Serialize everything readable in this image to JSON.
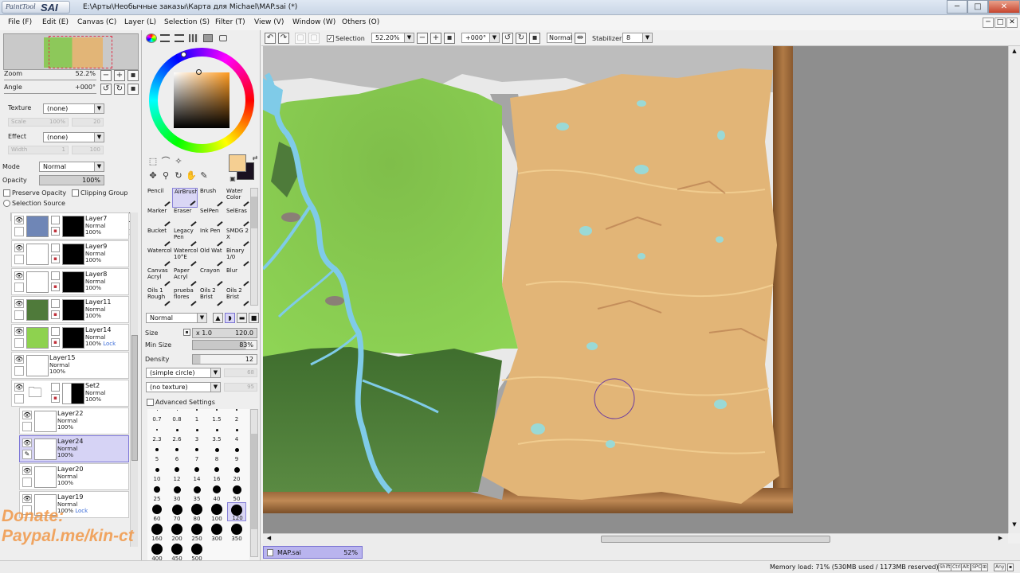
{
  "app": {
    "logo_small": "PaintTool",
    "logo_big": "SAI",
    "title": "E:\\Арты\\Необычные заказы\\Карта для Michael\\MAP.sai (*)"
  },
  "window_buttons": {
    "minimize": "─",
    "maximize": "□",
    "close": "✕"
  },
  "menu": [
    "File (F)",
    "Edit (E)",
    "Canvas (C)",
    "Layer (L)",
    "Selection (S)",
    "Filter (T)",
    "View (V)",
    "Window (W)",
    "Others (O)"
  ],
  "navigator": {
    "zoom_label": "Zoom",
    "zoom_value": "52.2%",
    "angle_label": "Angle",
    "angle_value": "+000°"
  },
  "layer_props": {
    "texture_label": "Texture",
    "texture_value": "(none)",
    "scale_label": "Scale",
    "scale_value": "100%",
    "scale_num": "20",
    "effect_label": "Effect",
    "effect_value": "(none)",
    "width_label": "Width",
    "width_value": "1",
    "width_num": "100",
    "mode_label": "Mode",
    "mode_value": "Normal",
    "opacity_label": "Opacity",
    "opacity_value": "100%",
    "preserve_opacity": "Preserve Opacity",
    "clipping_group": "Clipping Group",
    "selection_source": "Selection Source"
  },
  "layers": [
    {
      "name": "Layer7",
      "mode": "Normal",
      "opacity": "100%",
      "thumb_color": "#6f86b6",
      "mask": true
    },
    {
      "name": "Layer9",
      "mode": "Normal",
      "opacity": "100%",
      "thumb_color": "#f4f4f4",
      "mask": true
    },
    {
      "name": "Layer8",
      "mode": "Normal",
      "opacity": "100%",
      "thumb_color": "#f4f4f4",
      "mask": true
    },
    {
      "name": "Layer11",
      "mode": "Normal",
      "opacity": "100%",
      "thumb_color": "#4f7a3a",
      "mask": true
    },
    {
      "name": "Layer14",
      "mode": "Normal",
      "opacity": "100%",
      "lock": "Lock",
      "thumb_color": "#8ed24f",
      "mask": true
    },
    {
      "name": "Layer15",
      "mode": "Normal",
      "opacity": "100%",
      "thumb_color": "#f4f4f4",
      "mask": false
    },
    {
      "name": "Set2",
      "mode": "Normal",
      "opacity": "100%",
      "thumb_color": "#f4f4f4",
      "mask": true,
      "folder": true
    },
    {
      "name": "Layer22",
      "mode": "Normal",
      "opacity": "100%",
      "thumb_color": "#f4f4f4",
      "mask": false,
      "sub": true
    },
    {
      "name": "Layer24",
      "mode": "Normal",
      "opacity": "100%",
      "thumb_color": "#f4f4f4",
      "mask": false,
      "sub": true,
      "selected": true
    },
    {
      "name": "Layer20",
      "mode": "Normal",
      "opacity": "100%",
      "thumb_color": "#f4f4f4",
      "mask": false,
      "sub": true
    },
    {
      "name": "Layer19",
      "mode": "Normal",
      "opacity": "100%",
      "lock": "Lock",
      "thumb_color": "#f4f4f4",
      "mask": false,
      "sub": true
    }
  ],
  "watermark": {
    "line1": "Donate:",
    "line2": "Paypal.me/kin-ct"
  },
  "tools": [
    {
      "label": "Pencil",
      "label2": ""
    },
    {
      "label": "AirBrush",
      "label2": "",
      "active": true
    },
    {
      "label": "Brush",
      "label2": ""
    },
    {
      "label": "Water",
      "label2": "Color"
    },
    {
      "label": "Marker",
      "label2": ""
    },
    {
      "label": "Eraser",
      "label2": ""
    },
    {
      "label": "SelPen",
      "label2": ""
    },
    {
      "label": "SelEras",
      "label2": ""
    },
    {
      "label": "Bucket",
      "label2": ""
    },
    {
      "label": "Legacy",
      "label2": "Pen"
    },
    {
      "label": "Ink Pen",
      "label2": ""
    },
    {
      "label": "SMDG 2",
      "label2": "X"
    },
    {
      "label": "Watercol",
      "label2": ""
    },
    {
      "label": "Watercol",
      "label2": "10°E"
    },
    {
      "label": "Old Wat",
      "label2": ""
    },
    {
      "label": "Binary",
      "label2": "1/0"
    },
    {
      "label": "Canvas",
      "label2": "Acryl"
    },
    {
      "label": "Paper",
      "label2": "Acryl"
    },
    {
      "label": "Crayon",
      "label2": ""
    },
    {
      "label": "Blur",
      "label2": ""
    },
    {
      "label": "Oils 1",
      "label2": "Rough"
    },
    {
      "label": "prueba",
      "label2": "flores"
    },
    {
      "label": "Oils 2",
      "label2": "Brist"
    },
    {
      "label": "Oils 2",
      "label2": "Brist"
    }
  ],
  "brush": {
    "blend_mode": "Normal",
    "size_label": "Size",
    "size_mult": "x 1.0",
    "size_value": "120.0",
    "min_size_label": "Min Size",
    "min_size_value": "83%",
    "density_label": "Density",
    "density_value": "12",
    "shape": "(simple circle)",
    "shape_num": "68",
    "texture": "(no texture)",
    "texture_num": "95",
    "advanced": "Advanced Settings"
  },
  "brush_sizes": [
    "0.7",
    "0.8",
    "1",
    "1.5",
    "2",
    "2.3",
    "2.6",
    "3",
    "3.5",
    "4",
    "5",
    "6",
    "7",
    "8",
    "9",
    "10",
    "12",
    "14",
    "16",
    "20",
    "25",
    "30",
    "35",
    "40",
    "50",
    "60",
    "70",
    "80",
    "100",
    "120",
    "160",
    "200",
    "250",
    "300",
    "350",
    "400",
    "450",
    "500"
  ],
  "canvas_toolbar": {
    "selection_label": "Selection",
    "zoom": "52.20%",
    "angle": "+000°",
    "blend": "Normal",
    "stabilizer_label": "Stabilizer",
    "stabilizer_value": "8"
  },
  "doc_tab": {
    "name": "MAP.sai",
    "zoom": "52%"
  },
  "status": {
    "memory": "Memory load: 71% (530MB used / 1173MB reserved)",
    "keys": [
      "Shift",
      "Ctrl",
      "Alt",
      "SPC",
      "Any"
    ]
  },
  "colors": {
    "accent": "#7a73d3",
    "selected_layer": "#d6d3f5",
    "parchment": "#e2b577",
    "grass": "#8dc85a",
    "forest": "#4c7a37",
    "river": "#8fd6ec",
    "wood": "#9a6a3b"
  },
  "icons": [
    "color-wheel-icon",
    "eye-icon",
    "folder-icon",
    "trash-icon",
    "new-layer-icon",
    "scroll-arrow-icon"
  ]
}
